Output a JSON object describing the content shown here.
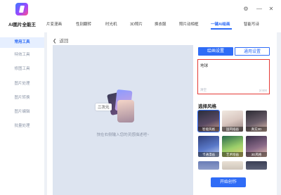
{
  "app": {
    "title": "AI图片全能王"
  },
  "sidebar": {
    "items": [
      {
        "label": "常用工具",
        "active": true
      },
      {
        "label": "特效工具",
        "active": false
      },
      {
        "label": "修图工具",
        "active": false
      },
      {
        "label": "图片处理",
        "active": false
      },
      {
        "label": "图片转换",
        "active": false
      },
      {
        "label": "图片编辑",
        "active": false
      },
      {
        "label": "批量处理",
        "active": false
      }
    ]
  },
  "tabs": [
    {
      "label": "片变漫画",
      "active": false
    },
    {
      "label": "性别翻转",
      "active": false
    },
    {
      "label": "时光机",
      "active": false
    },
    {
      "label": "3D照片",
      "active": false
    },
    {
      "label": "换衣服",
      "active": false
    },
    {
      "label": "照片动相框",
      "active": false
    },
    {
      "label": "一键AI绘画",
      "active": true
    },
    {
      "label": "智能写诗",
      "active": false
    }
  ],
  "window_controls": {
    "settings_icon": "gear-icon",
    "minimize": "—",
    "close": "✕"
  },
  "main": {
    "back_label": "返回",
    "illustration_tag": "二次元",
    "hint": "快在右侧输入您的灵感描述吧~"
  },
  "panel": {
    "tabs": [
      {
        "label": "绘画设置",
        "active": true
      },
      {
        "label": "通用设置",
        "active": false
      }
    ],
    "prompt": {
      "text": "地球",
      "count": "2/400",
      "clear": "清空"
    },
    "style_title": "选择风格",
    "styles": [
      {
        "label": "智能风格",
        "selected": true
      },
      {
        "label": "国风插画",
        "selected": false
      },
      {
        "label": "真实3D",
        "selected": false
      },
      {
        "label": "卡通漫画",
        "selected": false
      },
      {
        "label": "艺术绘画",
        "selected": false
      },
      {
        "label": "3D风格",
        "selected": false
      }
    ],
    "start_button": "开始创作"
  },
  "colors": {
    "accent": "#2f6cf6",
    "highlight_border": "#e53935"
  }
}
